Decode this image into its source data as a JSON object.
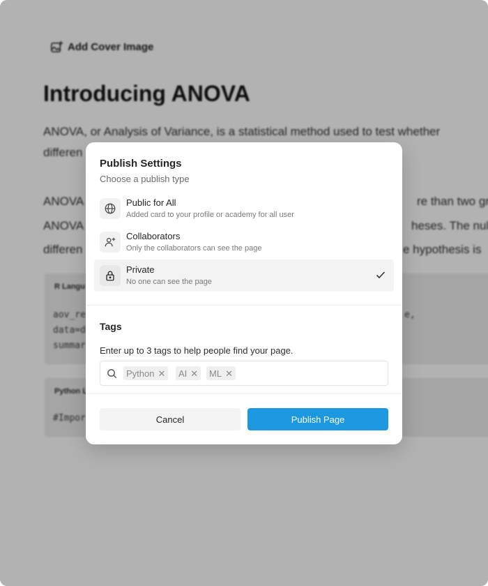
{
  "background": {
    "cover_button_label": "Add Cover Image",
    "title": "Introducing ANOVA",
    "paragraph1": [
      "ANOVA, or Analysis of Variance, is a statistical method used to test whether",
      "differen"
    ],
    "paragraph2": [
      "ANOVA",
      "re than two gro",
      "ANOVA",
      "heses. The nul",
      "differen",
      "e hypothesis is"
    ],
    "code_block_1": {
      "label": "R Langu",
      "lines": [
        "aov_re",
        "data=d",
        "summar"
      ],
      "line_right": "e,"
    },
    "code_block_2": {
      "label": "Python L",
      "lines": [
        "#Impor"
      ]
    }
  },
  "modal": {
    "title": "Publish Settings",
    "subtitle": "Choose a publish type",
    "options": [
      {
        "label": "Public for All",
        "description": "Added card to your profile or academy for all user",
        "icon": "globe-icon",
        "selected": false
      },
      {
        "label": "Collaborators",
        "description": "Only the collaborators can see the page",
        "icon": "user-add-icon",
        "selected": false
      },
      {
        "label": "Private",
        "description": "No one can see the page",
        "icon": "lock-icon",
        "selected": true
      }
    ],
    "tags": {
      "title": "Tags",
      "hint": "Enter up to 3 tags to help people find your page.",
      "items": [
        "Python",
        "AI",
        "ML"
      ]
    },
    "cancel_label": "Cancel",
    "publish_label": "Publish Page",
    "accent_color": "#1b98e0"
  }
}
